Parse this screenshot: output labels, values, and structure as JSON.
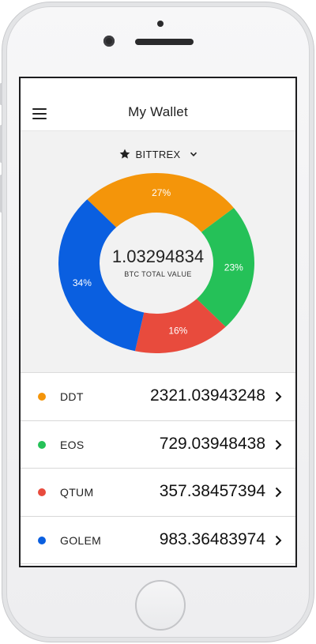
{
  "app": {
    "title": "My Wallet"
  },
  "exchange": {
    "name": "BITTREX",
    "icon": "star-icon",
    "dropdown_icon": "chevron-down-icon"
  },
  "total": {
    "value": "1.03294834",
    "label": "BTC TOTAL VALUE"
  },
  "chart_data": {
    "type": "pie",
    "categories": [
      "DDT",
      "EOS",
      "QTUM",
      "GOLEM"
    ],
    "values": [
      27,
      23,
      16,
      34
    ],
    "labels": [
      "27%",
      "23%",
      "16%",
      "34%"
    ],
    "colors": [
      "#f4950a",
      "#25c158",
      "#e84b3d",
      "#0a5fe0"
    ],
    "donut": true
  },
  "coins": [
    {
      "name": "DDT",
      "amount": "2321.03943248",
      "color": "#f4950a"
    },
    {
      "name": "EOS",
      "amount": "729.03948438",
      "color": "#25c158"
    },
    {
      "name": "QTUM",
      "amount": "357.38457394",
      "color": "#e84b3d"
    },
    {
      "name": "GOLEM",
      "amount": "983.36483974",
      "color": "#0a5fe0"
    }
  ]
}
